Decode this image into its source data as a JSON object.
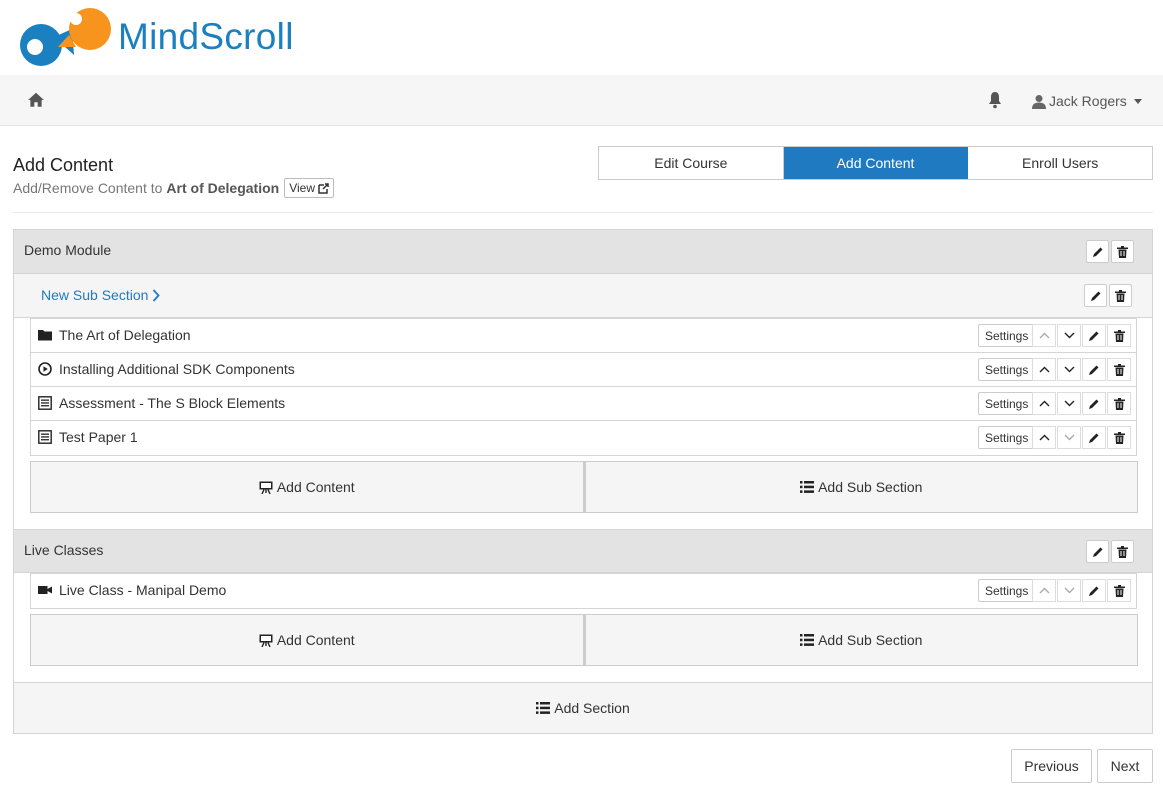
{
  "brand": {
    "name": "MindScroll",
    "color": "#1b80c0",
    "accent": "#f7941d"
  },
  "navbar": {
    "home_icon": "home-icon",
    "bell_icon": "bell-icon",
    "user_name": "Jack Rogers"
  },
  "header": {
    "title": "Add Content",
    "subtitle_prefix": "Add/Remove Content to",
    "course_name": "Art of Delegation",
    "view_label": "View"
  },
  "tabs": [
    {
      "label": "Edit Course",
      "active": false
    },
    {
      "label": "Add Content",
      "active": true
    },
    {
      "label": "Enroll Users",
      "active": false
    }
  ],
  "modules": [
    {
      "title": "Demo Module",
      "sub_section": {
        "title": "New Sub Section",
        "items": [
          {
            "label": "The Art of Delegation",
            "icon": "folder-icon",
            "settings": "Settings"
          },
          {
            "label": "Installing Additional SDK Components",
            "icon": "play-circle-icon",
            "settings": "Settings"
          },
          {
            "label": "Assessment - The S Block Elements",
            "icon": "list-alt-icon",
            "settings": "Settings"
          },
          {
            "label": "Test Paper 1",
            "icon": "list-alt-icon",
            "settings": "Settings"
          }
        ]
      },
      "add_content": "Add Content",
      "add_sub_section": "Add Sub Section"
    },
    {
      "title": "Live Classes",
      "items": [
        {
          "label": "Live Class - Manipal Demo",
          "icon": "video-camera-icon",
          "settings": "Settings"
        }
      ],
      "add_content": "Add Content",
      "add_sub_section": "Add Sub Section"
    }
  ],
  "add_section": "Add Section",
  "pager": {
    "previous": "Previous",
    "next": "Next"
  },
  "colors": {
    "primary": "#1f7ac1",
    "module_bg": "#e3e3e3",
    "sub_bg": "#f5f5f5"
  }
}
